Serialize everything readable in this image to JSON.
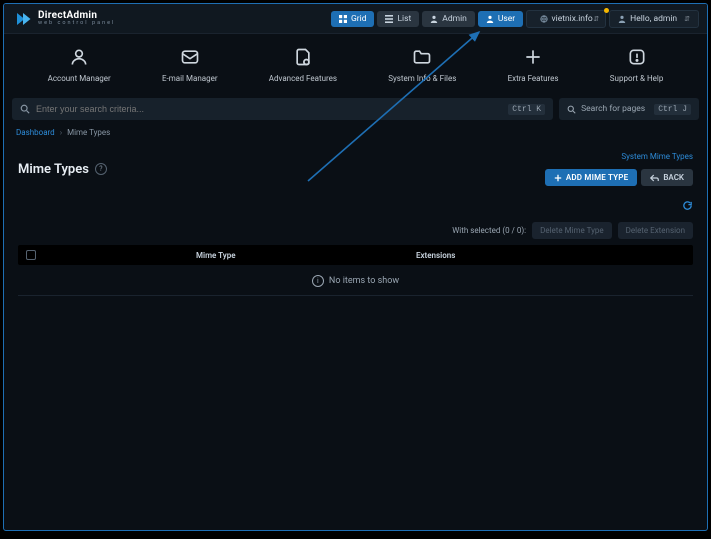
{
  "header": {
    "brand_title": "DirectAdmin",
    "brand_sub": "web control panel",
    "grid_label": "Grid",
    "list_label": "List",
    "admin_label": "Admin",
    "user_label": "User",
    "domain_label": "vietnix.info",
    "greeting_label": "Hello, admin"
  },
  "nav": {
    "items": [
      {
        "label": "Account Manager"
      },
      {
        "label": "E-mail Manager"
      },
      {
        "label": "Advanced Features"
      },
      {
        "label": "System Info & Files"
      },
      {
        "label": "Extra Features"
      },
      {
        "label": "Support & Help"
      }
    ]
  },
  "search": {
    "placeholder": "Enter your search criteria...",
    "kbd_main": "Ctrl K",
    "pages_label": "Search for pages",
    "kbd_pages": "Ctrl J"
  },
  "breadcrumb": {
    "root": "Dashboard",
    "current": "Mime Types"
  },
  "title": {
    "text": "Mime Types",
    "system_link": "System Mime Types",
    "add_label": "ADD MIME TYPE",
    "back_label": "BACK"
  },
  "selected": {
    "text": "With selected (0 / 0):",
    "delete_type": "Delete Mime Type",
    "delete_ext": "Delete Extension"
  },
  "table": {
    "col_mime": "Mime Type",
    "col_ext": "Extensions",
    "empty_text": "No items to show"
  }
}
